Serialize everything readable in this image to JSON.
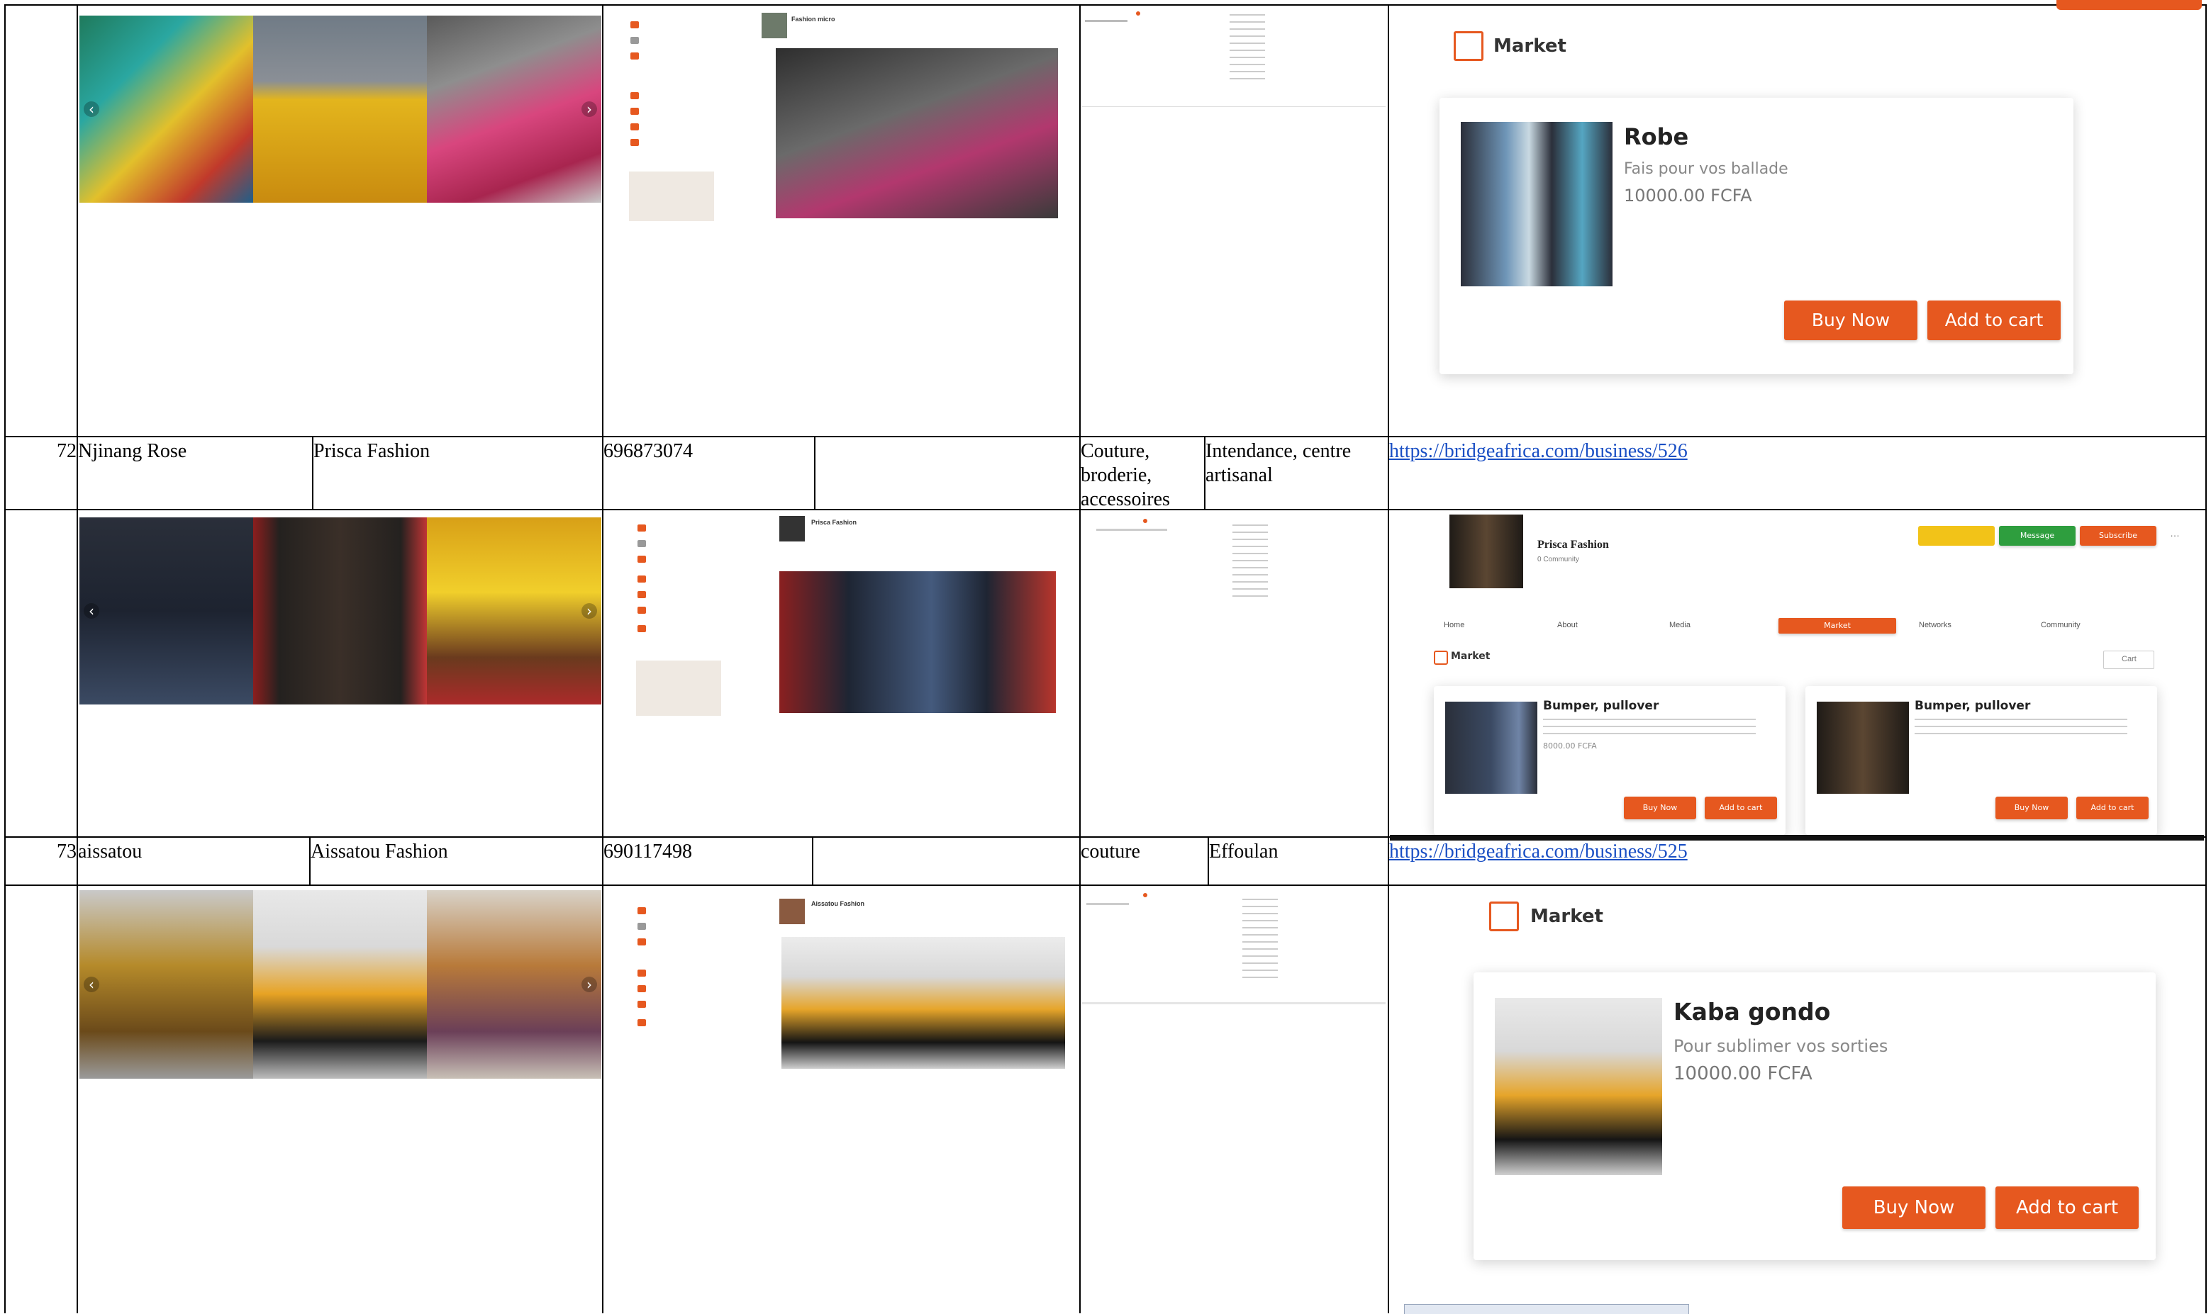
{
  "rows": [
    {
      "number": "72",
      "name": "Njinang Rose",
      "business": "Prisca Fashion",
      "phone": "696873074",
      "category": "Couture, broderie, accessoires",
      "location": "Intendance, centre artisanal",
      "url": "https://bridgeafrica.com/business/526"
    },
    {
      "number": "73",
      "name": "aissatou",
      "business": "Aissatou Fashion",
      "phone": "690117498",
      "category": "couture",
      "location": "Effoulan",
      "url": "https://bridgeafrica.com/business/525"
    }
  ],
  "market_top": {
    "title": "Market",
    "product": {
      "name": "Robe",
      "description": "Fais pour vos ballade",
      "price": "10000.00 FCFA"
    },
    "buy_label": "Buy Now",
    "cart_label": "Add to cart"
  },
  "market_mid": {
    "business_name": "Prisca Fashion",
    "followers": "0 Community",
    "nav": [
      "Home",
      "About",
      "Media",
      "Market",
      "Networks",
      "Community"
    ],
    "section_title": "Market",
    "cart_label": "Cart",
    "products": [
      {
        "name": "Bumper, pullover",
        "price": "8000.00 FCFA",
        "buy": "Buy Now",
        "cart": "Add to cart"
      },
      {
        "name": "Bumper, pullover",
        "price": "",
        "buy": "Buy Now",
        "cart": "Add to cart"
      }
    ],
    "action_buttons": [
      "Message",
      "Subscribe"
    ]
  },
  "market_bottom": {
    "title": "Market",
    "product": {
      "name": "Kaba gondo",
      "description": "Pour sublimer vos sorties",
      "price": "10000.00 FCFA"
    },
    "buy_label": "Buy Now",
    "cart_label": "Add to cart"
  },
  "profile_thumbs": {
    "top_name": "Fashion micro",
    "mid_name": "Prisca Fashion",
    "bottom_name": "Aissatou Fashion"
  },
  "colors": {
    "accent": "#e6581f",
    "green": "#2e9e3e",
    "yellow": "#f2c318",
    "link": "#1a4fc4"
  }
}
